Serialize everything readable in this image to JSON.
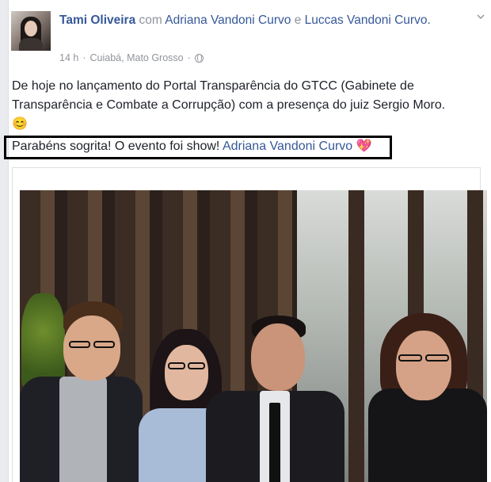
{
  "post": {
    "author": "Tami Oliveira",
    "with_word": "com",
    "tagged_1": "Adriana Vandoni Curvo",
    "and_word": "e",
    "tagged_2": "Luccas Vandoni Curvo.",
    "time": "14 h",
    "separator": "·",
    "location": "Cuiabá, Mato Grosso",
    "separator2": "·",
    "text": "De hoje no lançamento do Portal Transparência do GTCC (Gabinete de Transparência e Combate a Corrupção) com a presença do juiz Sergio Moro. 😊",
    "comment_text": "Parabéns sogrita! O evento foi show!",
    "comment_mention": "Adriana Vandoni Curvo",
    "comment_emoji": "💖"
  },
  "icons": {
    "chevron": "chevron-down-icon",
    "globe": "globe-icon"
  },
  "colors": {
    "link": "#365899",
    "meta": "#90949c",
    "text": "#1d2129"
  }
}
